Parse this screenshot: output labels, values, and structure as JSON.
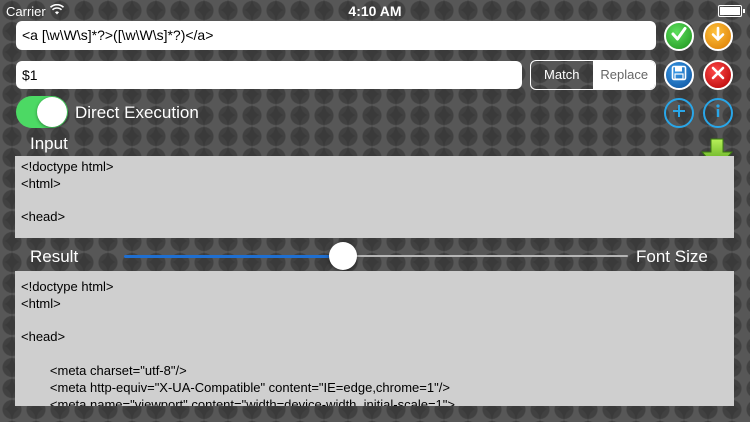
{
  "status_bar": {
    "carrier": "Carrier",
    "time": "4:10 AM",
    "wifi_icon": "wifi-icon",
    "battery_icon": "battery-icon"
  },
  "regex": {
    "pattern": "<a [\\w\\W\\s]*?>([\\w\\W\\s]*?)</a>"
  },
  "replacement": {
    "value": "$1"
  },
  "mode": {
    "options": [
      "Match",
      "Replace"
    ],
    "selected": "Match"
  },
  "toggle": {
    "label": "Direct Execution",
    "on": true
  },
  "input": {
    "label": "Input",
    "text": "<!doctype html>\n<html>\n\n<head>"
  },
  "result": {
    "label": "Result",
    "text": "<!doctype html>\n<html>\n\n<head>\n\n\t<meta charset=\"utf-8\"/>\n\t<meta http-equiv=\"X-UA-Compatible\" content=\"IE=edge,chrome=1\"/>\n\t<meta name=\"viewport\" content=\"width=device-width, initial-scale=1\">"
  },
  "font_size": {
    "label": "Font Size",
    "value_fraction": 0.43
  },
  "colors": {
    "accent_blue": "#29a6e8",
    "check_green": "#1d8f1d",
    "download_orange": "#d97800",
    "close_red": "#b00000",
    "toggle_green": "#4cd964",
    "slider_blue": "#1f6fd1"
  }
}
